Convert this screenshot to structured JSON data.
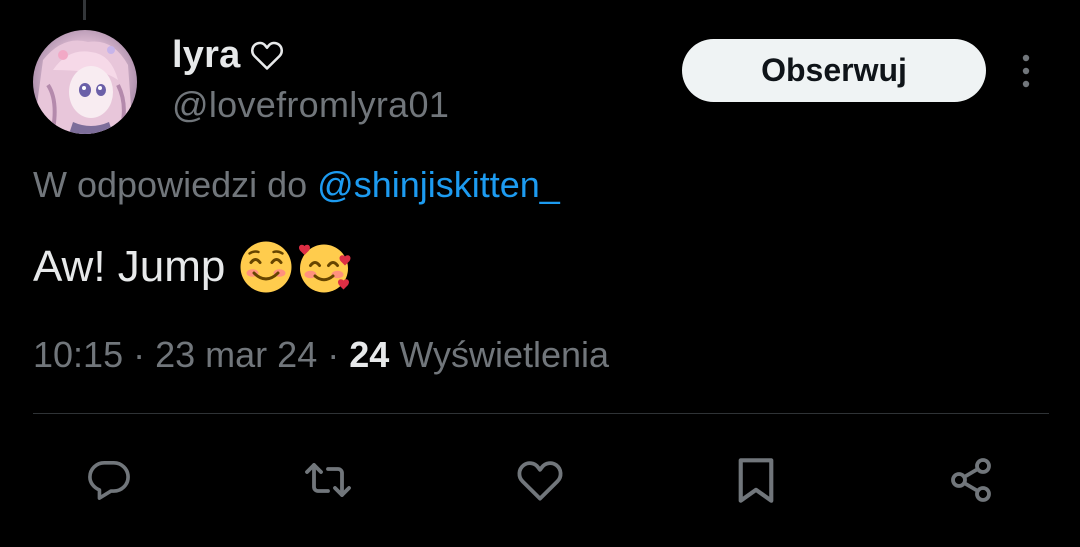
{
  "author": {
    "display_name": "lyra",
    "name_badge_icon": "heart-outline-icon",
    "handle": "@lovefromlyra01",
    "avatar_icon": "anime-avatar"
  },
  "follow_button": {
    "label": "Obserwuj"
  },
  "more_menu": {
    "icon": "more-vertical-icon"
  },
  "reply_context": {
    "prefix": "W odpowiedzi do",
    "mention": "@shinjiskitten_"
  },
  "tweet": {
    "text": "Aw! Jump",
    "emojis": [
      "smiling-face-emoji",
      "smiling-face-with-hearts-emoji"
    ]
  },
  "meta": {
    "time": "10:15",
    "separator": "·",
    "date": "23 mar 24",
    "views_count": "24",
    "views_label": "Wyświetlenia"
  },
  "actions": [
    {
      "name": "reply",
      "icon": "reply-bubble-icon"
    },
    {
      "name": "retweet",
      "icon": "retweet-icon"
    },
    {
      "name": "like",
      "icon": "heart-icon"
    },
    {
      "name": "bookmark",
      "icon": "bookmark-icon"
    },
    {
      "name": "share",
      "icon": "share-icon"
    }
  ],
  "colors": {
    "background": "#000000",
    "primary_text": "#e7e9ea",
    "secondary_text": "#71767b",
    "accent_link": "#1d9bf0",
    "follow_button_bg": "#eff3f4",
    "divider": "#2f3336"
  }
}
